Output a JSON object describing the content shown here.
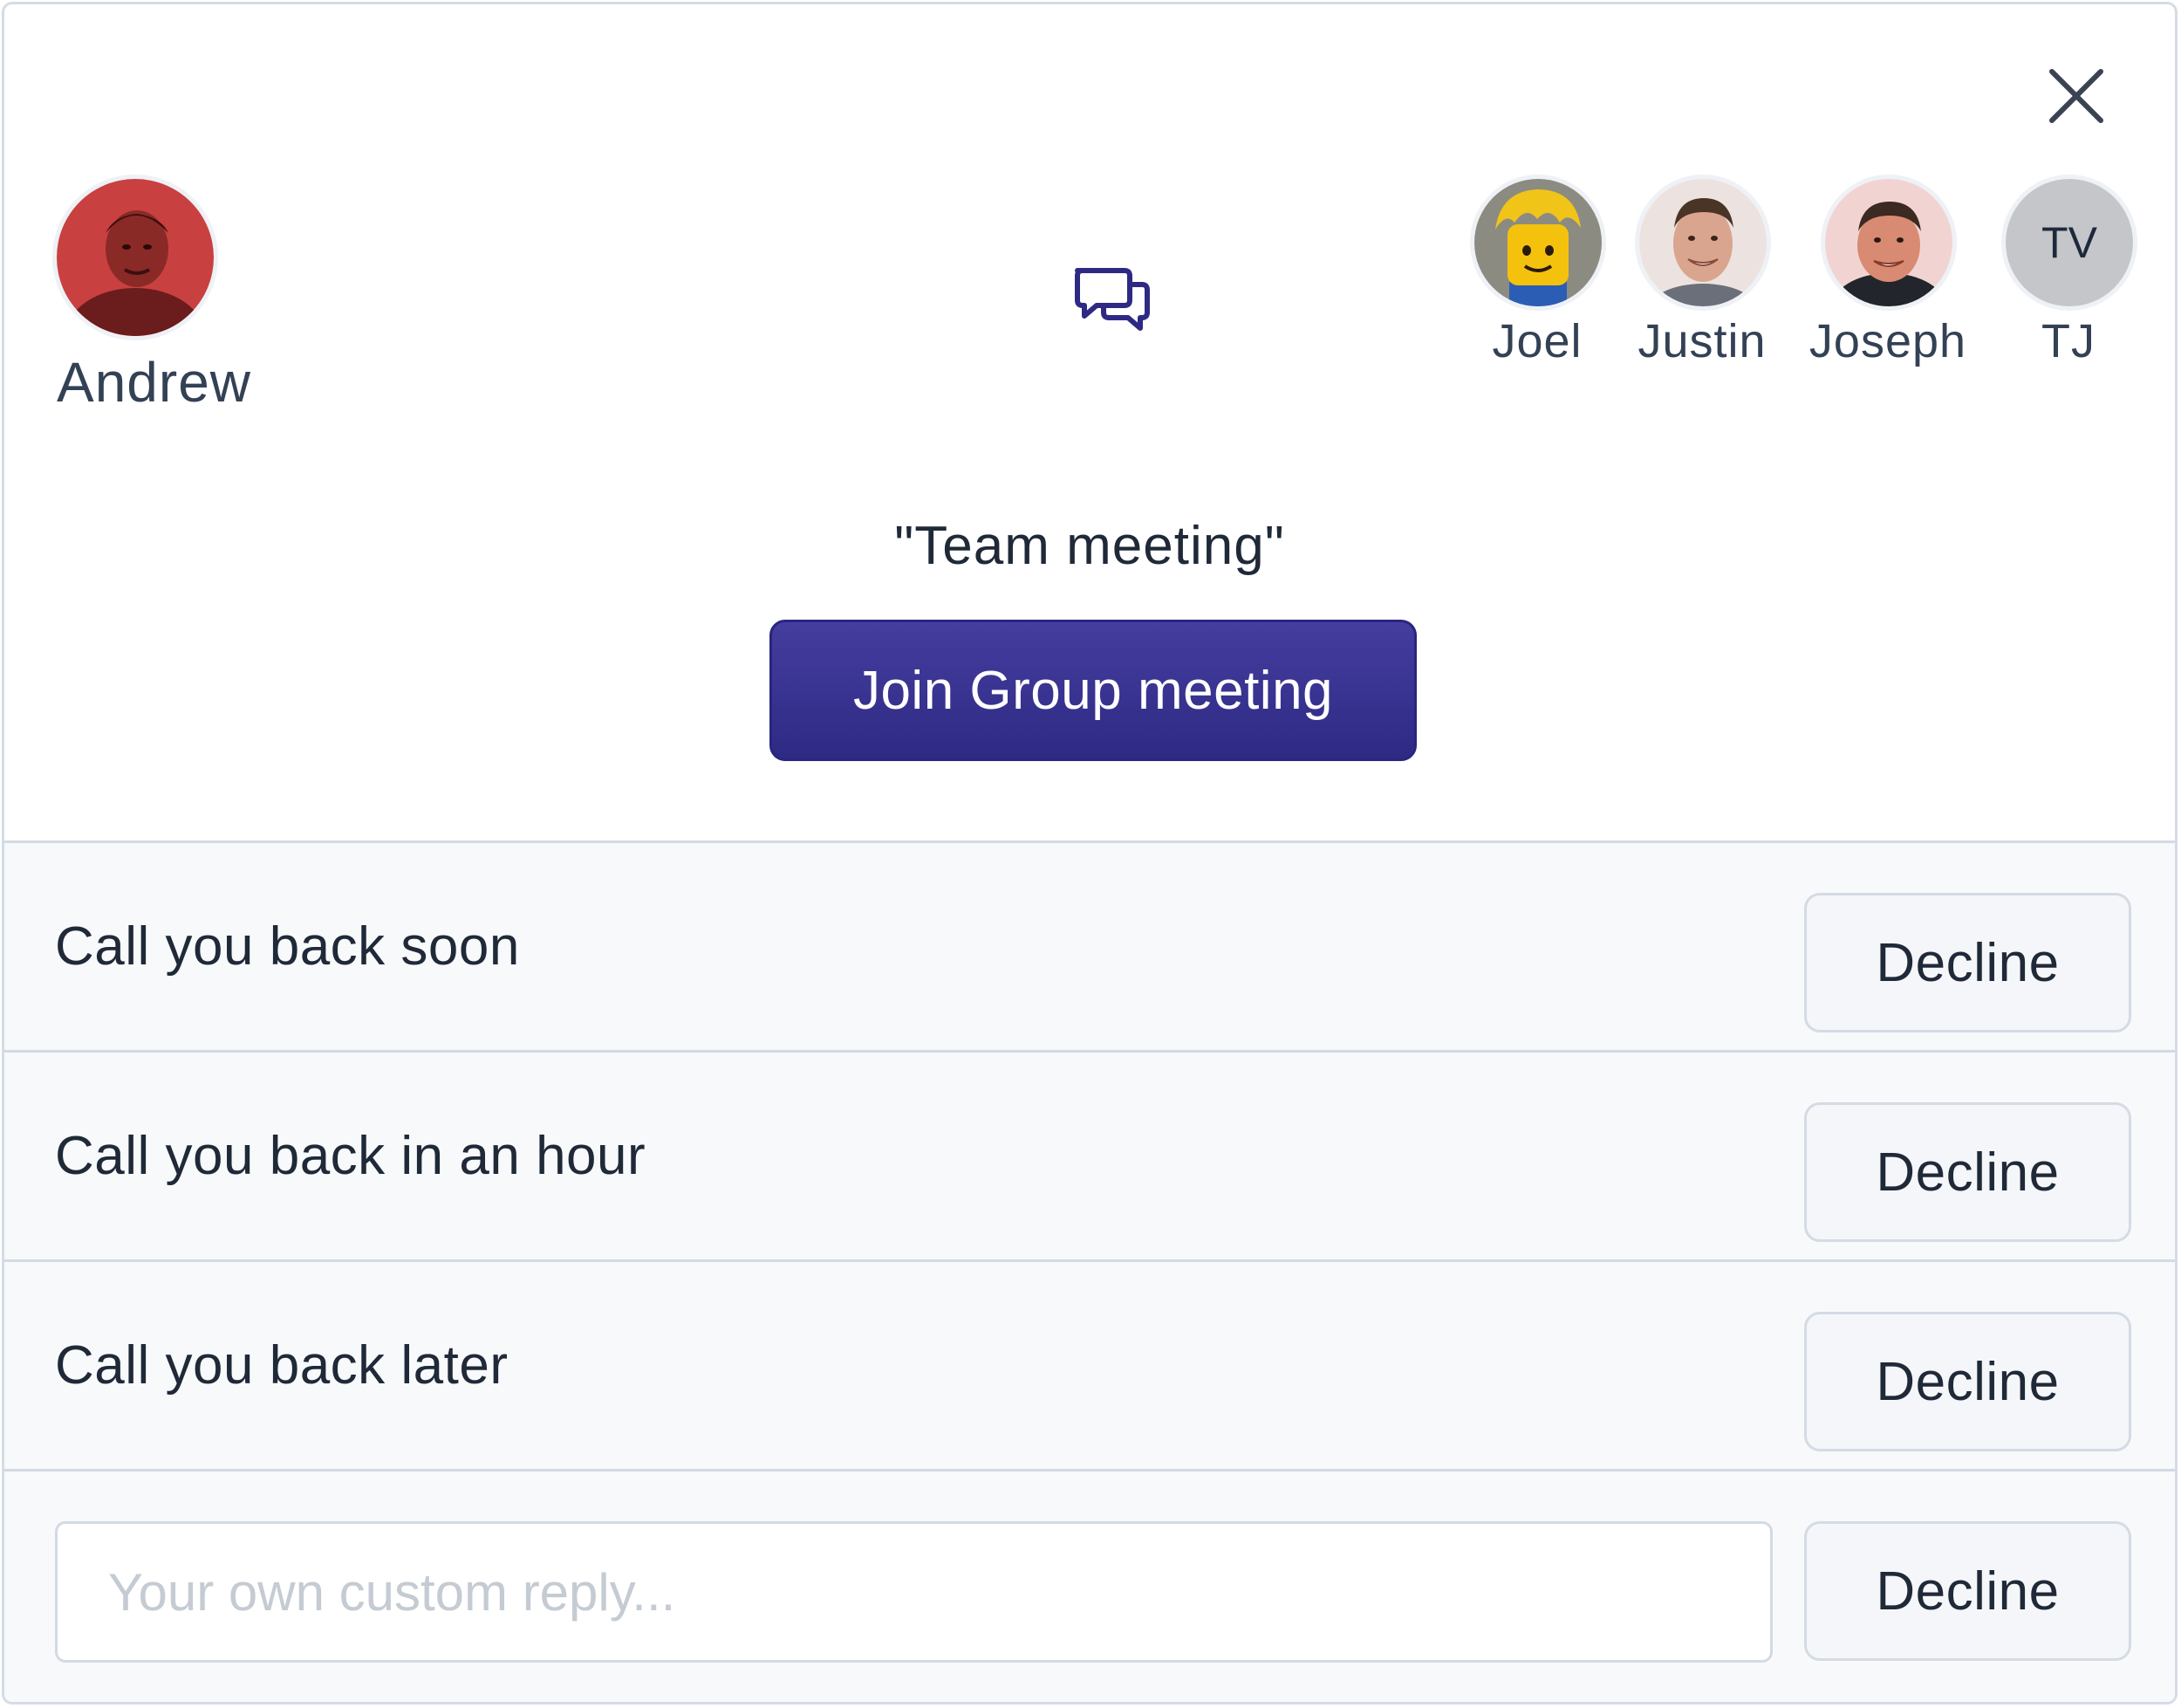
{
  "dialog": {
    "close_icon": "close-x-icon",
    "caller": {
      "name": "Andrew",
      "avatar": "photo"
    },
    "center_icon": "chat-bubbles-icon",
    "participants": [
      {
        "name": "Joel",
        "avatar": "photo"
      },
      {
        "name": "Justin",
        "avatar": "photo"
      },
      {
        "name": "Joseph",
        "avatar": "photo"
      },
      {
        "name": "TJ",
        "avatar": "initials",
        "initials": "TV"
      }
    ],
    "meeting_title": "\"Team meeting\"",
    "join_button_label": "Join Group meeting"
  },
  "replies": [
    {
      "text": "Call you back soon",
      "button": "Decline"
    },
    {
      "text": "Call you back in an hour",
      "button": "Decline"
    },
    {
      "text": "Call you back later",
      "button": "Decline"
    }
  ],
  "custom_reply": {
    "placeholder": "Your own custom reply...",
    "value": "",
    "button": "Decline"
  },
  "colors": {
    "accent": "#3a3491",
    "border": "#d3dae4",
    "reply_bg": "#f7f9fb",
    "text": "#1f2937",
    "muted_text": "#334155"
  }
}
